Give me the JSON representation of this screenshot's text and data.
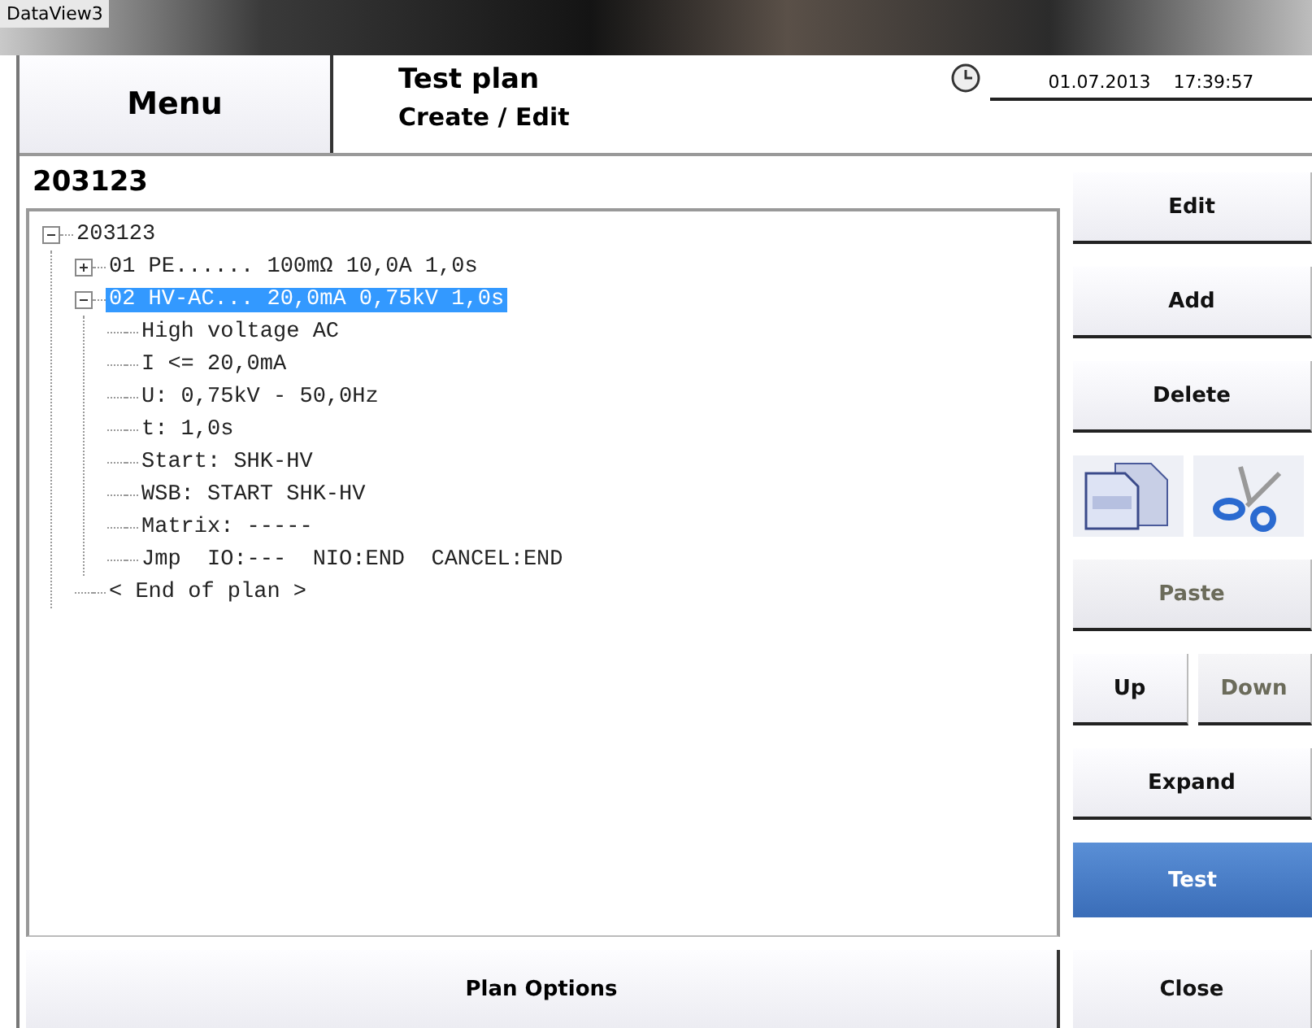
{
  "window": {
    "title": "DataView3"
  },
  "header": {
    "menu_button": "Menu",
    "title": "Test plan",
    "subtitle": "Create / Edit",
    "date": "01.07.2013",
    "time": "17:39:57"
  },
  "plan": {
    "heading": "203123",
    "tree": [
      {
        "label": "203123",
        "expanded": true,
        "selected": false,
        "children": [
          {
            "label": "01 PE...... 100mΩ 10,0A 1,0s",
            "expanded": false,
            "selected": false
          },
          {
            "label": "02 HV-AC... 20,0mA 0,75kV 1,0s",
            "expanded": true,
            "selected": true,
            "children": [
              {
                "label": "High voltage AC",
                "selected": false
              },
              {
                "label": "I <= 20,0mA",
                "selected": false
              },
              {
                "label": "U: 0,75kV - 50,0Hz",
                "selected": false
              },
              {
                "label": "t: 1,0s",
                "selected": false
              },
              {
                "label": "Start: SHK-HV",
                "selected": false
              },
              {
                "label": "WSB: START SHK-HV",
                "selected": false
              },
              {
                "label": "Matrix: -----",
                "selected": false
              },
              {
                "label": "Jmp  IO:---  NIO:END  CANCEL:END",
                "selected": false
              }
            ]
          },
          {
            "label": "< End of plan >",
            "selected": false
          }
        ]
      }
    ],
    "options_button": "Plan Options"
  },
  "actions": [
    {
      "kind": "button",
      "label": "Edit",
      "disabled": false
    },
    {
      "kind": "button",
      "label": "Add",
      "disabled": false
    },
    {
      "kind": "button",
      "label": "Delete",
      "disabled": false
    },
    {
      "kind": "clipboard"
    },
    {
      "kind": "button",
      "label": "Paste",
      "disabled": true
    },
    {
      "kind": "pair",
      "buttons": [
        {
          "label": "Up",
          "disabled": false
        },
        {
          "label": "Down",
          "disabled": true
        }
      ]
    },
    {
      "kind": "button",
      "label": "Expand",
      "disabled": false
    },
    {
      "kind": "primary",
      "label": "Test"
    }
  ],
  "close_button": "Close"
}
